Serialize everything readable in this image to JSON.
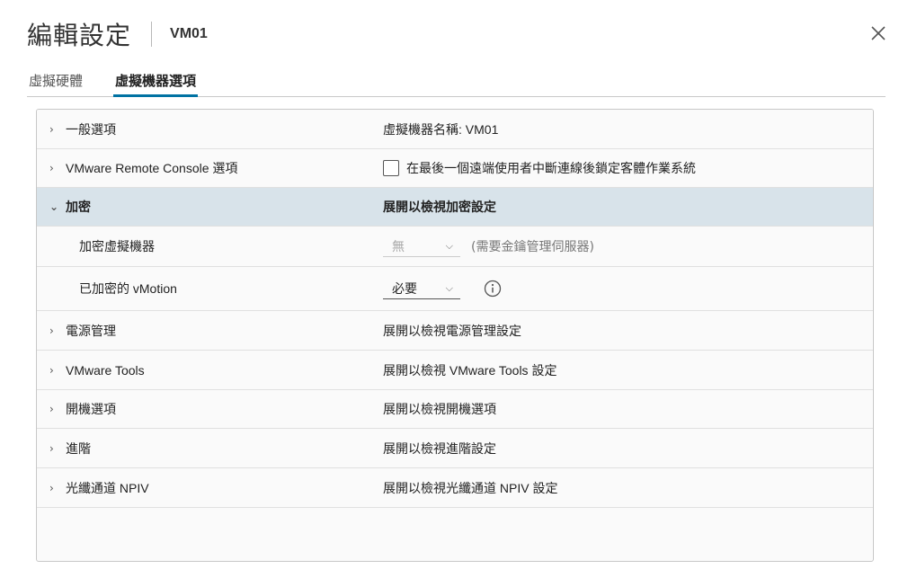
{
  "header": {
    "title": "編輯設定",
    "vm_name": "VM01"
  },
  "tabs": [
    {
      "label": "虛擬硬體"
    },
    {
      "label": "虛擬機器選項"
    }
  ],
  "rows": {
    "general": {
      "label": "一般選項",
      "value": "虛擬機器名稱: VM01"
    },
    "vmrc": {
      "label": "VMware Remote Console 選項",
      "value": "在最後一個遠端使用者中斷連線後鎖定客體作業系統"
    },
    "encryption": {
      "label": "加密",
      "value": "展開以檢視加密設定"
    },
    "encrypt_vm": {
      "label": "加密虛擬機器",
      "select_value": "無",
      "hint": "(需要金鑰管理伺服器)"
    },
    "encrypted_vmotion": {
      "label": "已加密的 vMotion",
      "select_value": "必要"
    },
    "power": {
      "label": "電源管理",
      "value": "展開以檢視電源管理設定"
    },
    "tools": {
      "label": "VMware Tools",
      "value": "展開以檢視 VMware Tools 設定"
    },
    "boot": {
      "label": "開機選項",
      "value": "展開以檢視開機選項"
    },
    "advanced": {
      "label": "進階",
      "value": "展開以檢視進階設定"
    },
    "npiv": {
      "label": "光纖通道 NPIV",
      "value": "展開以檢視光纖通道 NPIV 設定"
    }
  },
  "icons": {
    "close": "close-icon",
    "collapsed": "chevron-right-icon",
    "expanded": "chevron-down-icon",
    "info": "info-icon"
  },
  "colors": {
    "accent": "#0072a3",
    "expanded_row": "#d8e3ea"
  }
}
